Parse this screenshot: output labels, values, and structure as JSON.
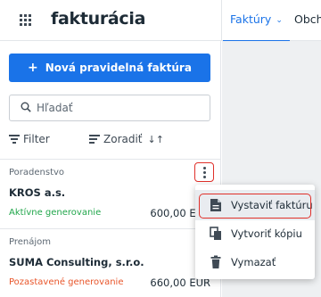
{
  "header": {
    "app_title": "fakturácia",
    "nav": [
      {
        "label": "Faktúry",
        "active": true,
        "has_dropdown": true
      },
      {
        "label": "Obch",
        "active": false,
        "has_dropdown": false
      }
    ]
  },
  "toolbar": {
    "new_button_label": "Nová pravidelná faktúra"
  },
  "search": {
    "placeholder": "Hľadať",
    "value": ""
  },
  "filters": {
    "filter_label": "Filter",
    "sort_label": "Zoradiť"
  },
  "list": {
    "items": [
      {
        "category": "Poradenstvo",
        "name": "KROS a.s.",
        "status": "Aktívne generovanie",
        "amount": "600,00 EUR"
      },
      {
        "category": "Prenájom",
        "name": "SUMA Consulting, s.r.o.",
        "status": "Pozastavené generovanie",
        "amount": "660,00 EUR"
      }
    ]
  },
  "menu": {
    "items": [
      {
        "label": "Vystaviť faktúru",
        "icon": "document-icon"
      },
      {
        "label": "Vytvoriť kópiu",
        "icon": "copy-icon"
      },
      {
        "label": "Vymazať",
        "icon": "trash-icon"
      }
    ]
  },
  "colors": {
    "accent": "#1a73e8",
    "status_active": "#21a64b",
    "status_paused": "#e8552a",
    "highlight_outline": "#e0302a"
  }
}
